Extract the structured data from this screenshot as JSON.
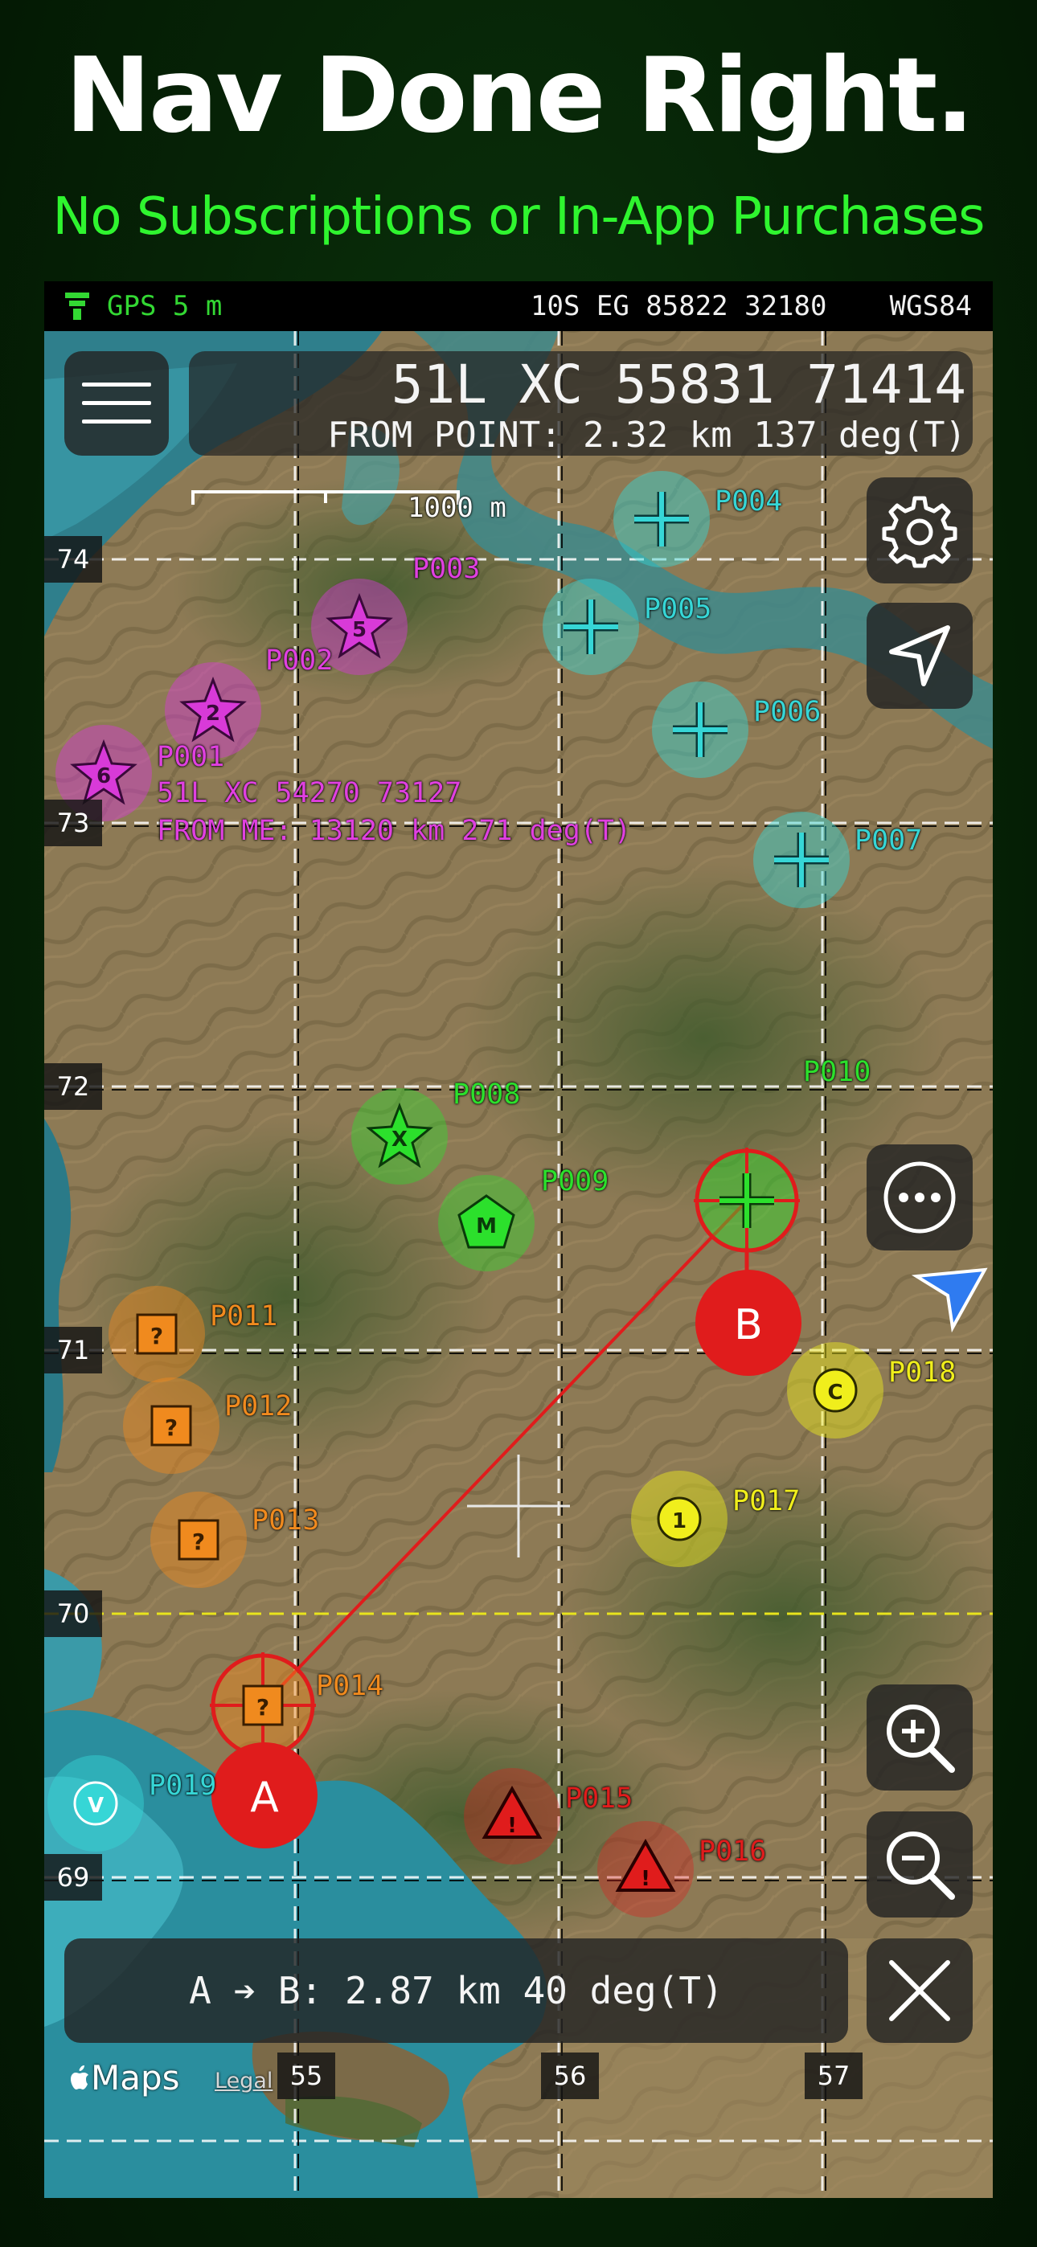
{
  "promo": {
    "headline": "Nav Done Right.",
    "subheadline": "No Subscriptions or In-App Purchases"
  },
  "status_bar": {
    "gps_label": "GPS 5 m",
    "grid_reference": "10S EG 85822 32180",
    "datum": "WGS84"
  },
  "coordinate_panel": {
    "coordinate": "51L XC 55831 71414",
    "from_point": "FROM POINT: 2.32 km 137 deg(T)"
  },
  "scale_bar": {
    "label": "1000 m"
  },
  "grid_labels": {
    "northing": [
      "74",
      "73",
      "72",
      "71",
      "70",
      "69"
    ],
    "easting": [
      "55",
      "56",
      "57"
    ]
  },
  "waypoints": [
    {
      "id": "P001",
      "glyph": "6",
      "category": "star",
      "color": "#d83ad8"
    },
    {
      "id": "P002",
      "glyph": "2",
      "category": "star",
      "color": "#d83ad8"
    },
    {
      "id": "P003",
      "glyph": "5",
      "category": "star",
      "color": "#d83ad8"
    },
    {
      "id": "P004",
      "glyph": "+",
      "category": "cross",
      "color": "#36d6d6"
    },
    {
      "id": "P005",
      "glyph": "+",
      "category": "cross",
      "color": "#36d6d6"
    },
    {
      "id": "P006",
      "glyph": "+",
      "category": "cross",
      "color": "#36d6d6"
    },
    {
      "id": "P007",
      "glyph": "+",
      "category": "cross",
      "color": "#36d6d6"
    },
    {
      "id": "P008",
      "glyph": "X",
      "category": "star",
      "color": "#2ce02c"
    },
    {
      "id": "P009",
      "glyph": "M",
      "category": "pentagon",
      "color": "#2ce02c"
    },
    {
      "id": "P010",
      "glyph": "+",
      "category": "cross",
      "color": "#2ce02c"
    },
    {
      "id": "P011",
      "glyph": "?",
      "category": "square",
      "color": "#f08a1e"
    },
    {
      "id": "P012",
      "glyph": "?",
      "category": "square",
      "color": "#f08a1e"
    },
    {
      "id": "P013",
      "glyph": "?",
      "category": "square",
      "color": "#f08a1e"
    },
    {
      "id": "P014",
      "glyph": "?",
      "category": "square",
      "color": "#f08a1e"
    },
    {
      "id": "P015",
      "glyph": "!",
      "category": "triangle",
      "color": "#e01c1c"
    },
    {
      "id": "P016",
      "glyph": "!",
      "category": "triangle",
      "color": "#e01c1c"
    },
    {
      "id": "P017",
      "glyph": "1",
      "category": "circle",
      "color": "#f0ee1c"
    },
    {
      "id": "P018",
      "glyph": "C",
      "category": "circle",
      "color": "#f0ee1c"
    },
    {
      "id": "P019",
      "glyph": "V",
      "category": "circle",
      "color": "#36d6d6"
    }
  ],
  "p001_details": {
    "coordinate": "51L XC 54270 73127",
    "from_me": "FROM ME: 13120 km 271 deg(T)"
  },
  "measure": {
    "point_a": "A",
    "point_b": "B",
    "ab_result": "A ➔ B: 2.87 km 40 deg(T)",
    "line_color": "#e01c1c"
  },
  "controls": {
    "menu_icon": "hamburger-menu-icon",
    "settings_icon": "gear-icon",
    "location_icon": "navigation-arrow-icon",
    "more_icon": "ellipsis-icon",
    "zoom_in_icon": "zoom-in-icon",
    "zoom_out_icon": "zoom-out-icon",
    "close_icon": "close-icon"
  },
  "attribution": {
    "maps_label": "Maps",
    "legal_label": "Legal"
  }
}
